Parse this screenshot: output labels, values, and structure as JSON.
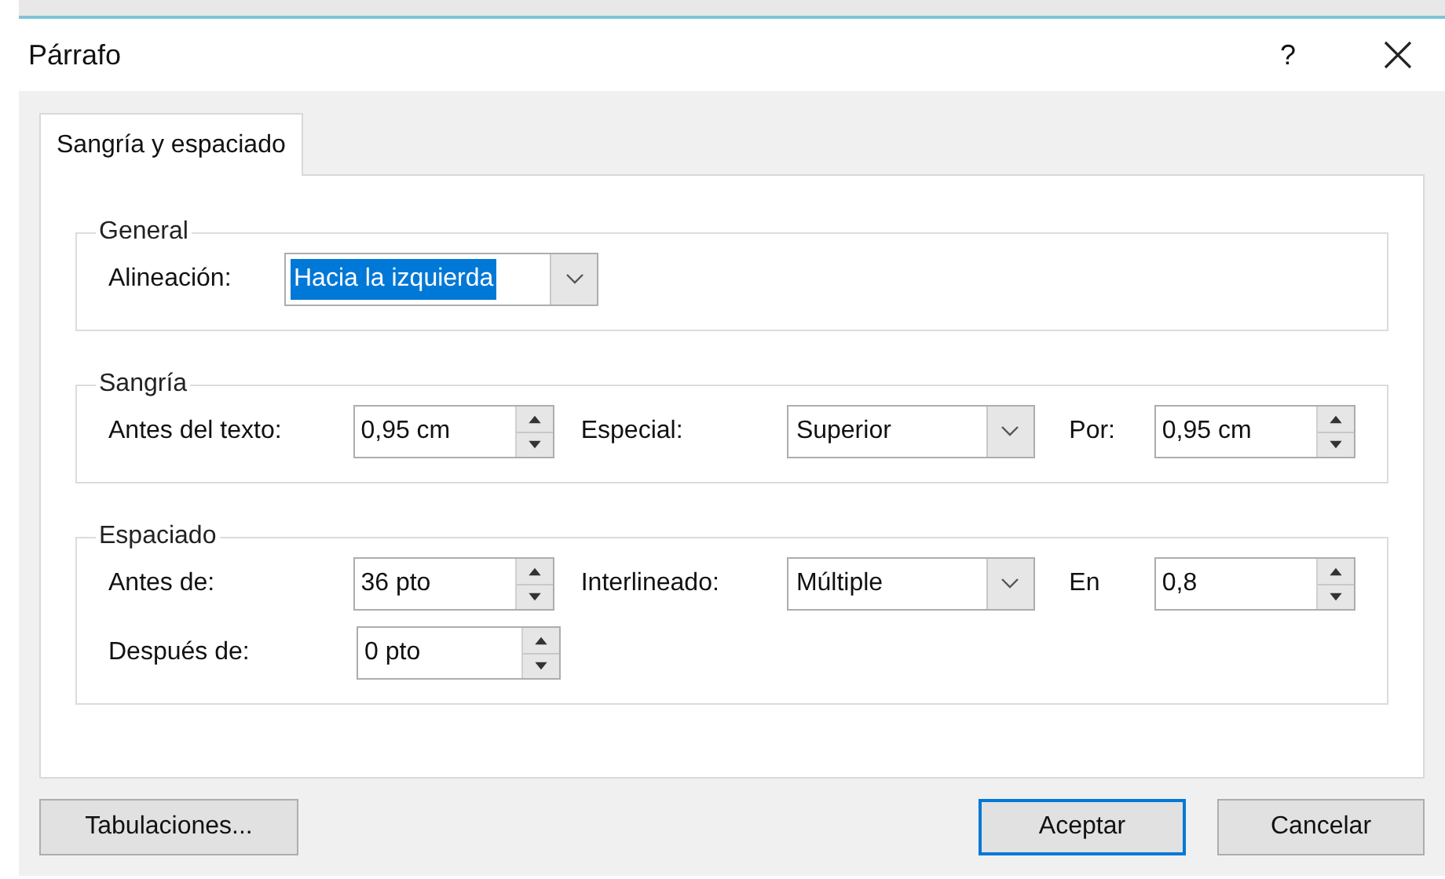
{
  "window": {
    "title": "Párrafo",
    "help": "?"
  },
  "tabs": [
    {
      "label": "Sangría y espaciado",
      "selected": true
    }
  ],
  "groups": [
    {
      "title": "General",
      "rows": [
        [
          {
            "label": "Alineación:",
            "kind": "combo",
            "value": "Hacia la izquierda",
            "highlighted": true
          }
        ]
      ]
    },
    {
      "title": "Sangría",
      "rows": [
        [
          {
            "label": "Antes del texto:",
            "kind": "spin",
            "value": "0,95 cm"
          },
          {
            "label": "Especial:",
            "kind": "combo",
            "value": "Superior",
            "highlighted": false
          },
          {
            "label": "Por:",
            "kind": "spin",
            "value": "0,95 cm"
          }
        ]
      ]
    },
    {
      "title": "Espaciado",
      "rows": [
        [
          {
            "label": "Antes de:",
            "kind": "spin",
            "value": "36 pto"
          },
          {
            "label": "Interlineado:",
            "kind": "combo",
            "value": "Múltiple",
            "highlighted": false
          },
          {
            "label": "En",
            "kind": "spin",
            "value": "0,8"
          }
        ],
        [
          {
            "label": "Después de:",
            "kind": "spin",
            "value": "0 pto"
          }
        ]
      ]
    }
  ],
  "buttons": [
    {
      "label": "Tabulaciones...",
      "default": false
    },
    {
      "label": "Aceptar",
      "default": true
    },
    {
      "label": "Cancelar",
      "default": false
    }
  ]
}
